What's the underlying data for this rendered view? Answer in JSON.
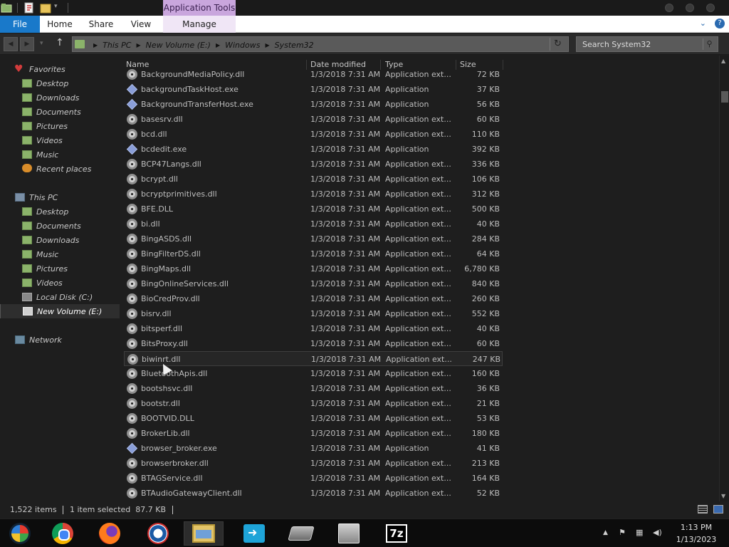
{
  "window": {
    "contextual_tab_group": "Application Tools"
  },
  "ribbon": {
    "tabs": [
      {
        "label": "File"
      },
      {
        "label": "Home"
      },
      {
        "label": "Share"
      },
      {
        "label": "View"
      },
      {
        "label": "Manage"
      }
    ]
  },
  "address": {
    "breadcrumbs": [
      "This PC",
      "New Volume (E:)",
      "Windows",
      "System32"
    ],
    "search_placeholder": "Search System32"
  },
  "nav_pane": {
    "favorites": {
      "label": "Favorites",
      "items": [
        "Desktop",
        "Downloads",
        "Documents",
        "Pictures",
        "Videos",
        "Music",
        "Recent places"
      ]
    },
    "this_pc": {
      "label": "This PC",
      "items": [
        "Desktop",
        "Documents",
        "Downloads",
        "Music",
        "Pictures",
        "Videos",
        "Local Disk (C:)",
        "New Volume (E:)"
      ],
      "selected": "New Volume (E:)"
    },
    "network": {
      "label": "Network"
    }
  },
  "file_list": {
    "columns": {
      "name": "Name",
      "date": "Date modified",
      "type": "Type",
      "size": "Size"
    },
    "selected_file": "biwinrt.dll",
    "files": [
      {
        "name": "BackgroundMediaPolicy.dll",
        "date": "1/3/2018 7:31 AM",
        "type": "Application ext...",
        "size": "72 KB",
        "kind": "dll"
      },
      {
        "name": "backgroundTaskHost.exe",
        "date": "1/3/2018 7:31 AM",
        "type": "Application",
        "size": "37 KB",
        "kind": "exe"
      },
      {
        "name": "BackgroundTransferHost.exe",
        "date": "1/3/2018 7:31 AM",
        "type": "Application",
        "size": "56 KB",
        "kind": "exe"
      },
      {
        "name": "basesrv.dll",
        "date": "1/3/2018 7:31 AM",
        "type": "Application ext...",
        "size": "60 KB",
        "kind": "dll"
      },
      {
        "name": "bcd.dll",
        "date": "1/3/2018 7:31 AM",
        "type": "Application ext...",
        "size": "110 KB",
        "kind": "dll"
      },
      {
        "name": "bcdedit.exe",
        "date": "1/3/2018 7:31 AM",
        "type": "Application",
        "size": "392 KB",
        "kind": "exe"
      },
      {
        "name": "BCP47Langs.dll",
        "date": "1/3/2018 7:31 AM",
        "type": "Application ext...",
        "size": "336 KB",
        "kind": "dll"
      },
      {
        "name": "bcrypt.dll",
        "date": "1/3/2018 7:31 AM",
        "type": "Application ext...",
        "size": "106 KB",
        "kind": "dll"
      },
      {
        "name": "bcryptprimitives.dll",
        "date": "1/3/2018 7:31 AM",
        "type": "Application ext...",
        "size": "312 KB",
        "kind": "dll"
      },
      {
        "name": "BFE.DLL",
        "date": "1/3/2018 7:31 AM",
        "type": "Application ext...",
        "size": "500 KB",
        "kind": "dll"
      },
      {
        "name": "bi.dll",
        "date": "1/3/2018 7:31 AM",
        "type": "Application ext...",
        "size": "40 KB",
        "kind": "dll"
      },
      {
        "name": "BingASDS.dll",
        "date": "1/3/2018 7:31 AM",
        "type": "Application ext...",
        "size": "284 KB",
        "kind": "dll"
      },
      {
        "name": "BingFilterDS.dll",
        "date": "1/3/2018 7:31 AM",
        "type": "Application ext...",
        "size": "64 KB",
        "kind": "dll"
      },
      {
        "name": "BingMaps.dll",
        "date": "1/3/2018 7:31 AM",
        "type": "Application ext...",
        "size": "6,780 KB",
        "kind": "dll"
      },
      {
        "name": "BingOnlineServices.dll",
        "date": "1/3/2018 7:31 AM",
        "type": "Application ext...",
        "size": "840 KB",
        "kind": "dll"
      },
      {
        "name": "BioCredProv.dll",
        "date": "1/3/2018 7:31 AM",
        "type": "Application ext...",
        "size": "260 KB",
        "kind": "dll"
      },
      {
        "name": "bisrv.dll",
        "date": "1/3/2018 7:31 AM",
        "type": "Application ext...",
        "size": "552 KB",
        "kind": "dll"
      },
      {
        "name": "bitsperf.dll",
        "date": "1/3/2018 7:31 AM",
        "type": "Application ext...",
        "size": "40 KB",
        "kind": "dll"
      },
      {
        "name": "BitsProxy.dll",
        "date": "1/3/2018 7:31 AM",
        "type": "Application ext...",
        "size": "60 KB",
        "kind": "dll"
      },
      {
        "name": "biwinrt.dll",
        "date": "1/3/2018 7:31 AM",
        "type": "Application ext...",
        "size": "247 KB",
        "kind": "dll"
      },
      {
        "name": "BluetoothApis.dll",
        "date": "1/3/2018 7:31 AM",
        "type": "Application ext...",
        "size": "160 KB",
        "kind": "dll"
      },
      {
        "name": "bootshsvc.dll",
        "date": "1/3/2018 7:31 AM",
        "type": "Application ext...",
        "size": "36 KB",
        "kind": "dll"
      },
      {
        "name": "bootstr.dll",
        "date": "1/3/2018 7:31 AM",
        "type": "Application ext...",
        "size": "21 KB",
        "kind": "dll"
      },
      {
        "name": "BOOTVID.DLL",
        "date": "1/3/2018 7:31 AM",
        "type": "Application ext...",
        "size": "53 KB",
        "kind": "dll"
      },
      {
        "name": "BrokerLib.dll",
        "date": "1/3/2018 7:31 AM",
        "type": "Application ext...",
        "size": "180 KB",
        "kind": "dll"
      },
      {
        "name": "browser_broker.exe",
        "date": "1/3/2018 7:31 AM",
        "type": "Application",
        "size": "41 KB",
        "kind": "exe"
      },
      {
        "name": "browserbroker.dll",
        "date": "1/3/2018 7:31 AM",
        "type": "Application ext...",
        "size": "213 KB",
        "kind": "dll"
      },
      {
        "name": "BTAGService.dll",
        "date": "1/3/2018 7:31 AM",
        "type": "Application ext...",
        "size": "164 KB",
        "kind": "dll"
      },
      {
        "name": "BTAudioGatewayClient.dll",
        "date": "1/3/2018 7:31 AM",
        "type": "Application ext...",
        "size": "52 KB",
        "kind": "dll"
      }
    ]
  },
  "status_bar": {
    "item_count": "1,522 items",
    "selection": "1 item selected  87.7 KB"
  },
  "taskbar": {
    "apps": [
      "start-orb-icon",
      "chrome-icon",
      "firefox-icon",
      "campaign-logo-icon",
      "file-explorer-icon",
      "share-arrow-icon",
      "hard-drive-icon",
      "server-icon",
      "seven-zip-icon"
    ],
    "active_app": "file-explorer-icon",
    "clock_time": "1:13 PM",
    "clock_date": "1/13/2023"
  }
}
